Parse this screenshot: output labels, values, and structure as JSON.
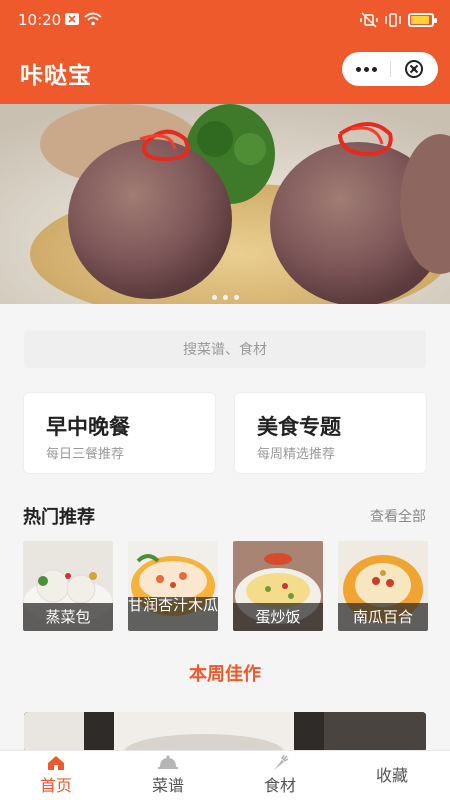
{
  "status_bar": {
    "time": "10:20"
  },
  "header": {
    "title": "咔哒宝"
  },
  "search": {
    "placeholder": "搜菜谱、食材"
  },
  "cards": [
    {
      "title": "早中晚餐",
      "subtitle": "每日三餐推荐"
    },
    {
      "title": "美食专题",
      "subtitle": "每周精选推荐"
    }
  ],
  "hot": {
    "title": "热门推荐",
    "see_all": "查看全部",
    "items": [
      {
        "name": "蒸菜包"
      },
      {
        "name": "甘润杏汁木瓜"
      },
      {
        "name": "蛋炒饭"
      },
      {
        "name": "南瓜百合"
      }
    ]
  },
  "weekly": {
    "title": "本周佳作"
  },
  "tabs": [
    {
      "label": "首页",
      "icon": "home-icon",
      "active": true
    },
    {
      "label": "菜谱",
      "icon": "cloche-icon",
      "active": false
    },
    {
      "label": "食材",
      "icon": "carrot-icon",
      "active": false
    },
    {
      "label": "收藏",
      "icon": "",
      "active": false
    }
  ],
  "colors": {
    "brand": "#ee5a2c",
    "battery": "#ffd23a"
  }
}
